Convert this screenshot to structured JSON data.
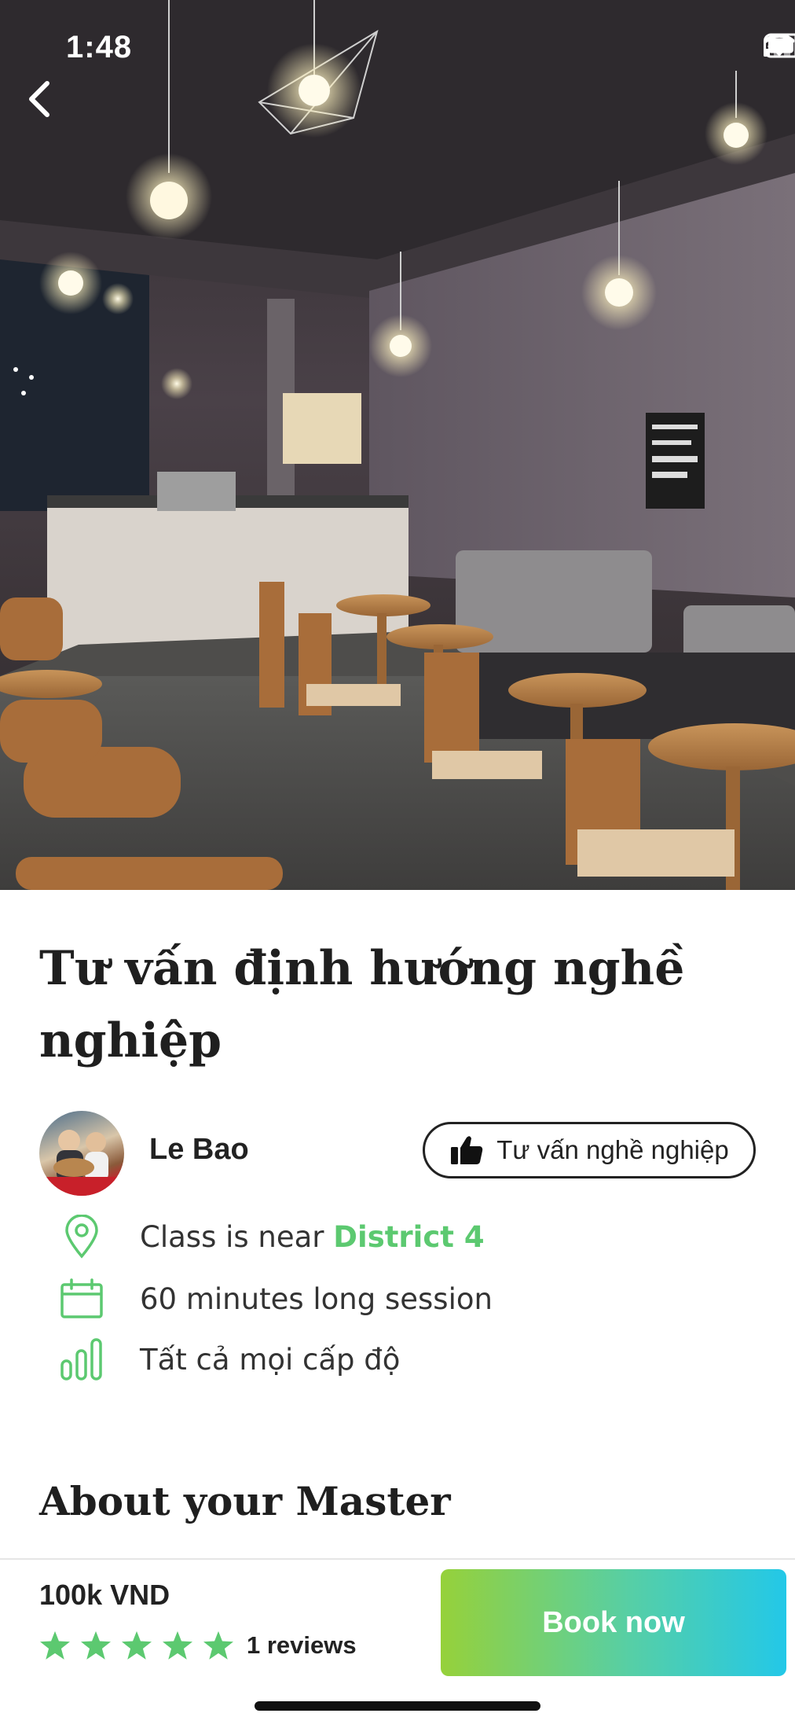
{
  "status_bar": {
    "time": "1:48"
  },
  "class": {
    "title": "Tư vấn định hướng nghề nghiệp"
  },
  "master": {
    "name": "Le Bao",
    "category": "Tư vấn nghề nghiệp"
  },
  "details": {
    "location_prefix": "Class is near",
    "location": "District 4",
    "duration": "60 minutes long session",
    "level": "Tất cả mọi cấp độ"
  },
  "sections": {
    "about_heading": "About your Master"
  },
  "booking": {
    "price": "100k VND",
    "rating": 5,
    "reviews": "1 reviews",
    "book_label": "Book now"
  },
  "colors": {
    "accent_green": "#5cc970",
    "star_green": "#5cc970",
    "button_gradient_start": "#96d13a",
    "button_gradient_end": "#23c8e8"
  },
  "icons": {
    "back": "chevron-left-icon",
    "location": "location-pin-icon",
    "duration": "calendar-icon",
    "level": "bar-chart-icon",
    "category": "thumbs-up-icon",
    "rating": "star-icon"
  }
}
